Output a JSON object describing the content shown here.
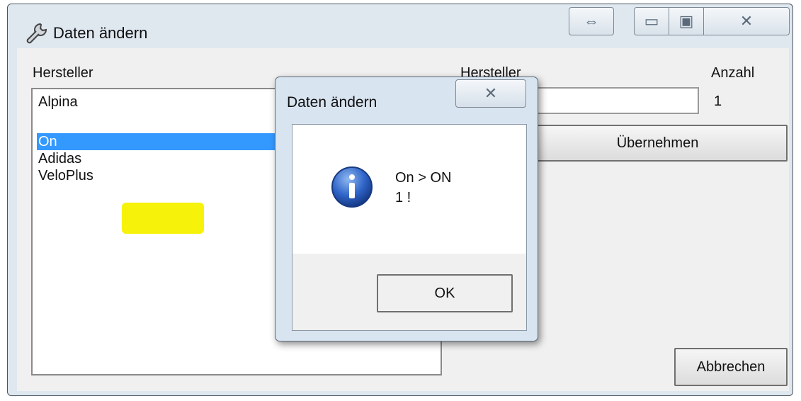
{
  "window": {
    "title": "Daten ändern",
    "buttons": {
      "resize_icon": "⇔",
      "minimize_icon": "▭",
      "maximize_icon": "▣",
      "close_icon": "✕"
    }
  },
  "left_panel": {
    "label": "Hersteller",
    "items": [
      "Alpina",
      "",
      "On",
      "Adidas",
      "VeloPlus"
    ],
    "selected_index": 2
  },
  "right_panel": {
    "hersteller_label": "Hersteller",
    "hersteller_value": "",
    "anzahl_label": "Anzahl",
    "anzahl_value": "1",
    "apply_button": "Übernehmen",
    "cancel_button": "Abbrechen"
  },
  "dialog": {
    "title": "Daten ändern",
    "close_icon": "✕",
    "message_line1": "On > ON",
    "message_line2": "1 !",
    "ok_button": "OK",
    "colors": {
      "highlight": "#f6f20a",
      "selection": "#3399ff"
    }
  }
}
